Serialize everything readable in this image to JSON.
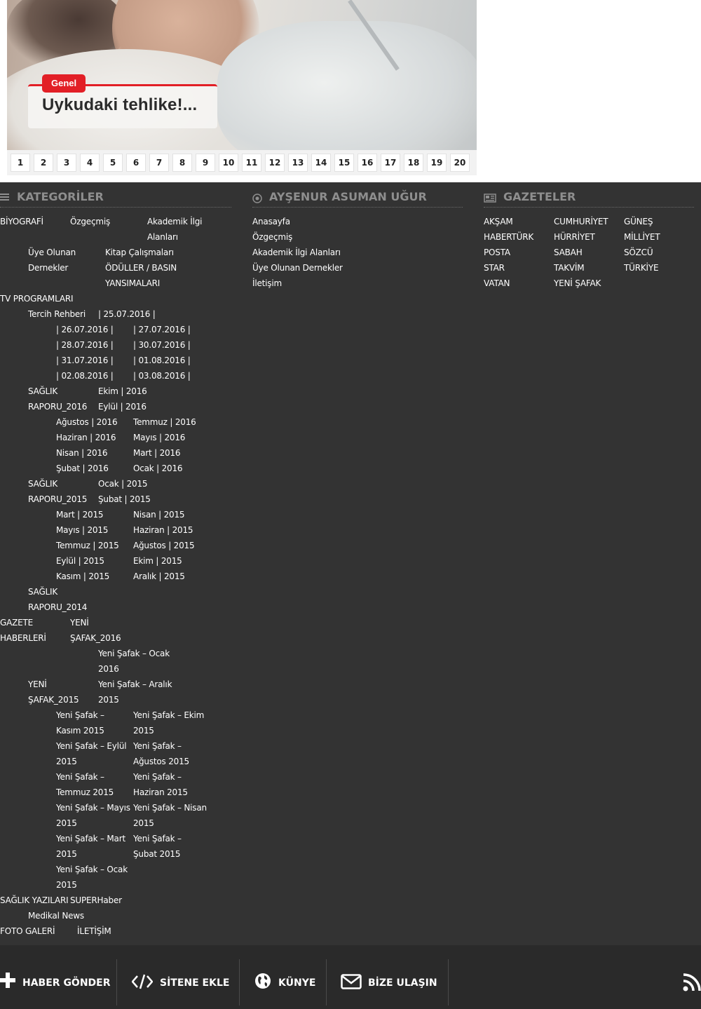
{
  "slider": {
    "category_badge": "Genel",
    "headline": "Uykudaki tehlike!...",
    "pages": [
      "1",
      "2",
      "3",
      "4",
      "5",
      "6",
      "7",
      "8",
      "9",
      "10",
      "11",
      "12",
      "13",
      "14",
      "15",
      "16",
      "17",
      "18",
      "19",
      "20"
    ]
  },
  "colors": {
    "accent_red": "#e21f26",
    "footer_bg": "#333333",
    "bottombar_bg": "#2a2a2a",
    "heading_gray": "#8e8e8e"
  },
  "kategoriler": {
    "title": "KATEGORİLER",
    "icon": "menu-lines-icon",
    "biyografi": "BİYOGRAFİ",
    "ozgecmis": "Özgeçmiş",
    "akademik_1": "Akademik İlgi",
    "akademik_2": "Alanları",
    "uye_1": "Üye Olunan",
    "uye_2": "Dernekler",
    "kitap": "Kitap Çalışmaları",
    "oduller_1": "ÖDÜLLER / BASIN",
    "oduller_2": "YANSIMALARI",
    "tv": "TV PROGRAMLARI",
    "tercih": "Tercih Rehberi",
    "dates": [
      "| 25.07.2016 |",
      "| 26.07.2016 |",
      "| 27.07.2016 |",
      "| 28.07.2016 |",
      "| 30.07.2016 |",
      "| 31.07.2016 |",
      "| 01.08.2016 |",
      "| 02.08.2016 |",
      "| 03.08.2016 |"
    ],
    "saglik": "SAĞLIK",
    "rapor2016": "RAPORU_2016",
    "months2016": [
      "Ekim | 2016",
      "Eylül | 2016",
      "Ağustos | 2016",
      "Temmuz | 2016",
      "Haziran | 2016",
      "Mayıs | 2016",
      "Nisan | 2016",
      "Mart | 2016",
      "Şubat | 2016",
      "Ocak | 2016"
    ],
    "rapor2015": "RAPORU_2015",
    "months2015": [
      "Ocak | 2015",
      "Şubat | 2015",
      "Mart | 2015",
      "Nisan | 2015",
      "Mayıs | 2015",
      "Haziran | 2015",
      "Temmuz | 2015",
      "Ağustos | 2015",
      "Eylül | 2015",
      "Ekim | 2015",
      "Kasım | 2015",
      "Aralık | 2015"
    ],
    "rapor2014": "RAPORU_2014",
    "gazete_1": "GAZETE",
    "gazete_2": "HABERLERİ",
    "ys2016_1": "YENİ",
    "ys2016_2": "ŞAFAK_2016",
    "ys_ocak2016_1": "Yeni Şafak – Ocak",
    "ys_ocak2016_2": "2016",
    "yeni": "YENİ",
    "ys2015": "ŞAFAK_2015",
    "ys_aralik_1": "Yeni Şafak – Aralık",
    "ys_aralik_2": "2015",
    "ys_items": [
      [
        "Yeni Şafak –",
        "Kasım 2015"
      ],
      [
        "Yeni Şafak – Ekim",
        "2015"
      ],
      [
        "Yeni Şafak – Eylül",
        "2015"
      ],
      [
        "Yeni Şafak –",
        "Ağustos 2015"
      ],
      [
        "Yeni Şafak –",
        "Temmuz 2015"
      ],
      [
        "Yeni Şafak –",
        "Haziran 2015"
      ],
      [
        "Yeni Şafak – Mayıs",
        "2015"
      ],
      [
        "Yeni Şafak – Nisan",
        "2015"
      ],
      [
        "Yeni Şafak – Mart",
        "2015"
      ],
      [
        "Yeni Şafak –",
        "Şubat 2015"
      ],
      [
        "Yeni Şafak – Ocak",
        "2015"
      ]
    ],
    "saglik_yazilari": "SAĞLIK YAZILARI",
    "superhaber": "SUPERHaber",
    "medikal": "Medikal News",
    "foto": "FOTO GALERİ",
    "iletisim": "İLETİŞİM"
  },
  "aysenur": {
    "title": "AYŞENUR ASUMAN UĞUR",
    "icon": "target-circle-icon",
    "links": [
      "Anasayfa",
      "Özgeçmiş",
      "Akademik İlgi Alanları",
      "Üye Olunan Dernekler",
      "İletişim"
    ]
  },
  "gazeteler": {
    "title": "GAZETELER",
    "icon": "newspaper-icon",
    "papers": [
      "AKŞAM",
      "CUMHURİYET",
      "GÜNEŞ",
      "HABERTÜRK",
      "HÜRRİYET",
      "MİLLİYET",
      "POSTA",
      "SABAH",
      "SÖZCÜ",
      "STAR",
      "TAKVİM",
      "TÜRKİYE",
      "VATAN",
      "YENİ ŞAFAK"
    ]
  },
  "bottombar": {
    "haber_gonder": "HABER GÖNDER",
    "sitene_ekle": "SİTENE EKLE",
    "kunye": "KÜNYE",
    "bize_ulasin": "BİZE ULAŞIN"
  }
}
